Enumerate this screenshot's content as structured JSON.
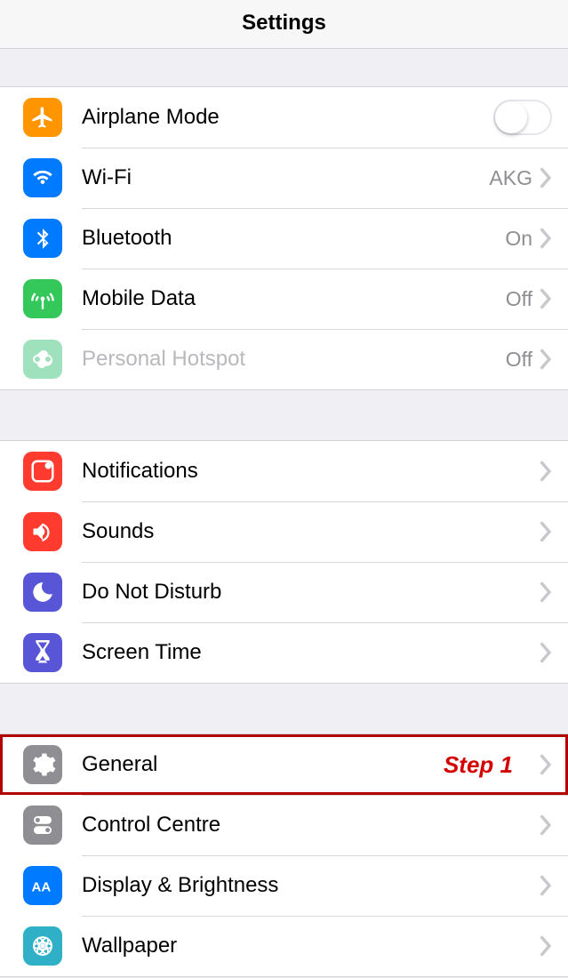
{
  "header": {
    "title": "Settings"
  },
  "annotation": "Step 1",
  "groups": [
    {
      "rows": [
        {
          "id": "airplane",
          "label": "Airplane Mode",
          "type": "toggle",
          "toggle": false
        },
        {
          "id": "wifi",
          "label": "Wi-Fi",
          "value": "AKG",
          "type": "link"
        },
        {
          "id": "bluetooth",
          "label": "Bluetooth",
          "value": "On",
          "type": "link"
        },
        {
          "id": "mobiledata",
          "label": "Mobile Data",
          "value": "Off",
          "type": "link"
        },
        {
          "id": "hotspot",
          "label": "Personal Hotspot",
          "value": "Off",
          "type": "link",
          "disabled": true
        }
      ]
    },
    {
      "rows": [
        {
          "id": "notifications",
          "label": "Notifications",
          "type": "link"
        },
        {
          "id": "sounds",
          "label": "Sounds",
          "type": "link"
        },
        {
          "id": "dnd",
          "label": "Do Not Disturb",
          "type": "link"
        },
        {
          "id": "screentime",
          "label": "Screen Time",
          "type": "link"
        }
      ]
    },
    {
      "rows": [
        {
          "id": "general",
          "label": "General",
          "type": "link",
          "highlight": true
        },
        {
          "id": "controlcentre",
          "label": "Control Centre",
          "type": "link"
        },
        {
          "id": "display",
          "label": "Display & Brightness",
          "type": "link"
        },
        {
          "id": "wallpaper",
          "label": "Wallpaper",
          "type": "link"
        }
      ]
    }
  ]
}
